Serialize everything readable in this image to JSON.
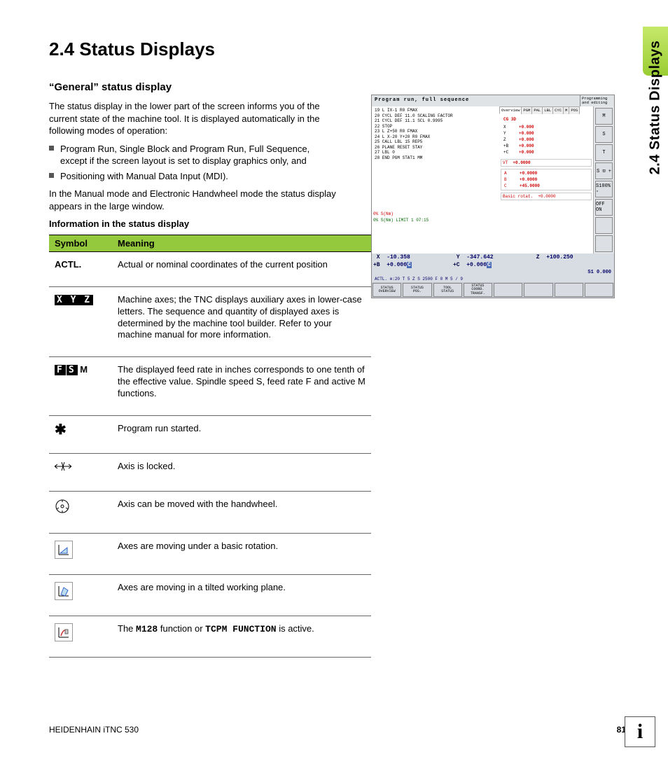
{
  "sidetab": "2.4 Status Displays",
  "h1": "2.4  Status Displays",
  "h2": "“General” status display",
  "intro": "The status display in the lower part of the screen informs you of the current state of the machine tool. It is displayed automatically in the following modes of operation:",
  "bullets": [
    "Program Run, Single Block and Program Run, Full Sequence, except if the screen layout is set to display graphics only, and",
    "Positioning with Manual Data Input (MDI)."
  ],
  "after": "In the Manual mode and Electronic Handwheel mode the status display appears in the large window.",
  "table_caption": "Information in the status display",
  "headers": {
    "sym": "Symbol",
    "mean": "Meaning"
  },
  "rows": [
    {
      "sym_text": "ACTL.",
      "sym_type": "bold",
      "mean": "Actual or nominal coordinates of the current position"
    },
    {
      "sym_text": "X Y Z",
      "sym_type": "inv",
      "mean": "Machine axes; the TNC displays auxiliary axes in lower-case letters. The sequence and quantity of displayed axes is determined by the machine tool builder. Refer to your machine manual for more information."
    },
    {
      "sym_text": "F S M",
      "sym_type": "fsm",
      "mean": "The displayed feed rate in inches corresponds to one tenth of the effective value. Spindle speed S, feed rate F and active M functions."
    },
    {
      "sym_text": "✱",
      "sym_type": "glyph",
      "mean": "Program run started."
    },
    {
      "sym_text": "axis-lock",
      "sym_type": "svg-axislock",
      "mean": "Axis is locked."
    },
    {
      "sym_text": "handwheel",
      "sym_type": "svg-handwheel",
      "mean": "Axis can be moved with the handwheel."
    },
    {
      "sym_text": "basicrot",
      "sym_type": "svg-basicrot",
      "mean": "Axes are moving under a basic rotation."
    },
    {
      "sym_text": "tilted",
      "sym_type": "svg-tilted",
      "mean": "Axes are moving in a tilted working plane."
    },
    {
      "sym_text": "tcpm",
      "sym_type": "svg-tcpm",
      "mean_html": "The <b class='mono'>M128</b> function or <b class='mono'>TCPM FUNCTION</b> is active."
    }
  ],
  "screenshot": {
    "title": "Program run, full sequence",
    "mode": "Programming and editing",
    "program": [
      "19 L IX-1 R0 FMAX",
      "20 CYCL DEF 11.0 SCALING FACTOR",
      "21 CYCL DEF 11.1 SCL 0.9995",
      "22 STOP",
      "23 L Z+50 R0 FMAX",
      "24 L  X-20  Y+20 R0 FMAX",
      "25 CALL LBL 15 REP5",
      "26 PLANE RESET STAY",
      "27 LBL 0",
      "28 END PGM STAT1 MM"
    ],
    "tabbar": [
      "Overview",
      "PGM",
      "PAL",
      "LBL",
      "CYC",
      "M",
      "POS"
    ],
    "overview_hdr": "CG 3D",
    "ov_rows": [
      [
        "X",
        "+0.000"
      ],
      [
        "Y",
        "+0.000"
      ],
      [
        "Z",
        "+0.000"
      ],
      [
        "+B",
        "+0.000"
      ],
      [
        "+C",
        "+0.000"
      ]
    ],
    "vt": "+0.0000",
    "abc": [
      [
        "A",
        "+0.0000"
      ],
      [
        "B",
        "+0.0000"
      ],
      [
        "C",
        "+45.0000"
      ]
    ],
    "basic": [
      "Basic rotat.",
      "+0.0000"
    ],
    "time1": "0% S(Nm)",
    "time2": "0% S(Nm)  LIMIT 1 07:15",
    "coord_row1": [
      [
        "X",
        "-10.358"
      ],
      [
        "Y",
        "-347.642"
      ],
      [
        "Z",
        "+100.250"
      ]
    ],
    "coord_row2": [
      [
        "+B",
        "+0.000"
      ],
      [
        "+C",
        "+0.000"
      ]
    ],
    "sline": "S1   0.000",
    "bottom": "ACTL.        ⊕:20       T 5       Z S 2500     F 0      M 5 / 9",
    "softkeys": [
      "STATUS OVERVIEW",
      "STATUS POS.",
      "TOOL STATUS",
      "STATUS COORD. TRANSF.",
      "",
      "",
      "",
      ""
    ],
    "sidelabels": [
      "M",
      "S",
      "T",
      "S ⊡ +",
      "S100% ▫",
      "OFF ON",
      "",
      ""
    ]
  },
  "footer_left": "HEIDENHAIN iTNC 530",
  "footer_page": "81"
}
